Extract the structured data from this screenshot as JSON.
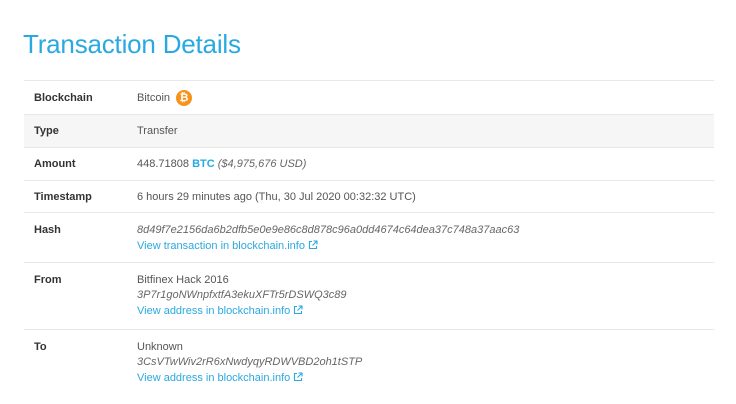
{
  "page": {
    "title": "Transaction Details"
  },
  "rows": {
    "blockchain": {
      "label": "Blockchain",
      "value": "Bitcoin",
      "icon": "bitcoin-icon",
      "icon_glyph": "₿"
    },
    "type": {
      "label": "Type",
      "value": "Transfer"
    },
    "amount": {
      "label": "Amount",
      "value": "448.71808",
      "currency": "BTC",
      "usd": "($4,975,676 USD)"
    },
    "timestamp": {
      "label": "Timestamp",
      "value": "6 hours 29 minutes ago (Thu, 30 Jul 2020 00:32:32 UTC)"
    },
    "hash": {
      "label": "Hash",
      "value": "8d49f7e2156da6b2dfb5e0e9e86c8d878c96a0dd4674c64dea37c748a37aac63",
      "link": "View transaction in blockchain.info"
    },
    "from": {
      "label": "From",
      "owner": "Bitfinex Hack 2016",
      "address": "3P7r1goNWnpfxtfA3ekuXFTr5rDSWQ3c89",
      "link": "View address in blockchain.info"
    },
    "to": {
      "label": "To",
      "owner": "Unknown",
      "address": "3CsVTwWiv2rR6xNwdyqyRDWVBD2oh1tSTP",
      "link": "View address in blockchain.info"
    }
  },
  "colors": {
    "accent": "#2aa9e0",
    "bitcoin": "#f7931a",
    "row_shade": "#f6f6f6",
    "divider": "#e8e8e8"
  }
}
